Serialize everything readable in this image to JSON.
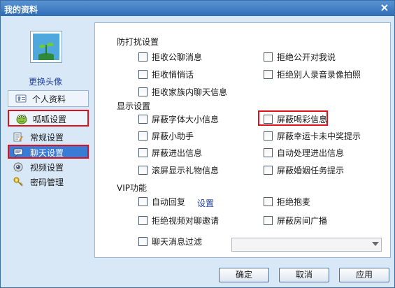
{
  "window": {
    "title": "我的资料",
    "close_label": "×"
  },
  "sidebar": {
    "avatar_icon": "plant-icon",
    "change_avatar": "更换头像",
    "personal": "个人资料",
    "guagua": "呱呱设置",
    "sub_items": [
      {
        "label": "常规设置",
        "icon": "doc-edit-icon"
      },
      {
        "label": "聊天设置",
        "icon": "chat-icon"
      },
      {
        "label": "视频设置",
        "icon": "camera-icon"
      },
      {
        "label": "密码管理",
        "icon": "key-icon"
      }
    ]
  },
  "sections": {
    "disturb": {
      "title": "防打扰设置",
      "options": [
        "拒收公聊消息",
        "拒绝公开对我说",
        "拒收悄悄话",
        "拒绝别人录音录像拍照",
        "拒收家族内聊天信息"
      ]
    },
    "display": {
      "title": "显示设置",
      "options": [
        "屏蔽字体大小信息",
        "屏蔽喝彩信息",
        "屏蔽小助手",
        "屏蔽幸运卡未中奖提示",
        "屏蔽进出信息",
        "自动处理进出信息",
        "滚屏显示礼物信息",
        "屏蔽婚姻任务提示"
      ]
    },
    "vip": {
      "title": "VIP功能",
      "options": [
        "自动回复",
        "拒绝抱麦",
        "拒绝视频对聊邀请",
        "屏蔽房间广播",
        "聊天消息过滤"
      ],
      "settings_link": "设置",
      "filter_value": ""
    }
  },
  "buttons": {
    "ok": "确定",
    "cancel": "取消",
    "apply": "应用"
  },
  "colors": {
    "accent": "#3a7bd5",
    "highlight_border": "#e0101a",
    "link": "#1c3f9c"
  }
}
